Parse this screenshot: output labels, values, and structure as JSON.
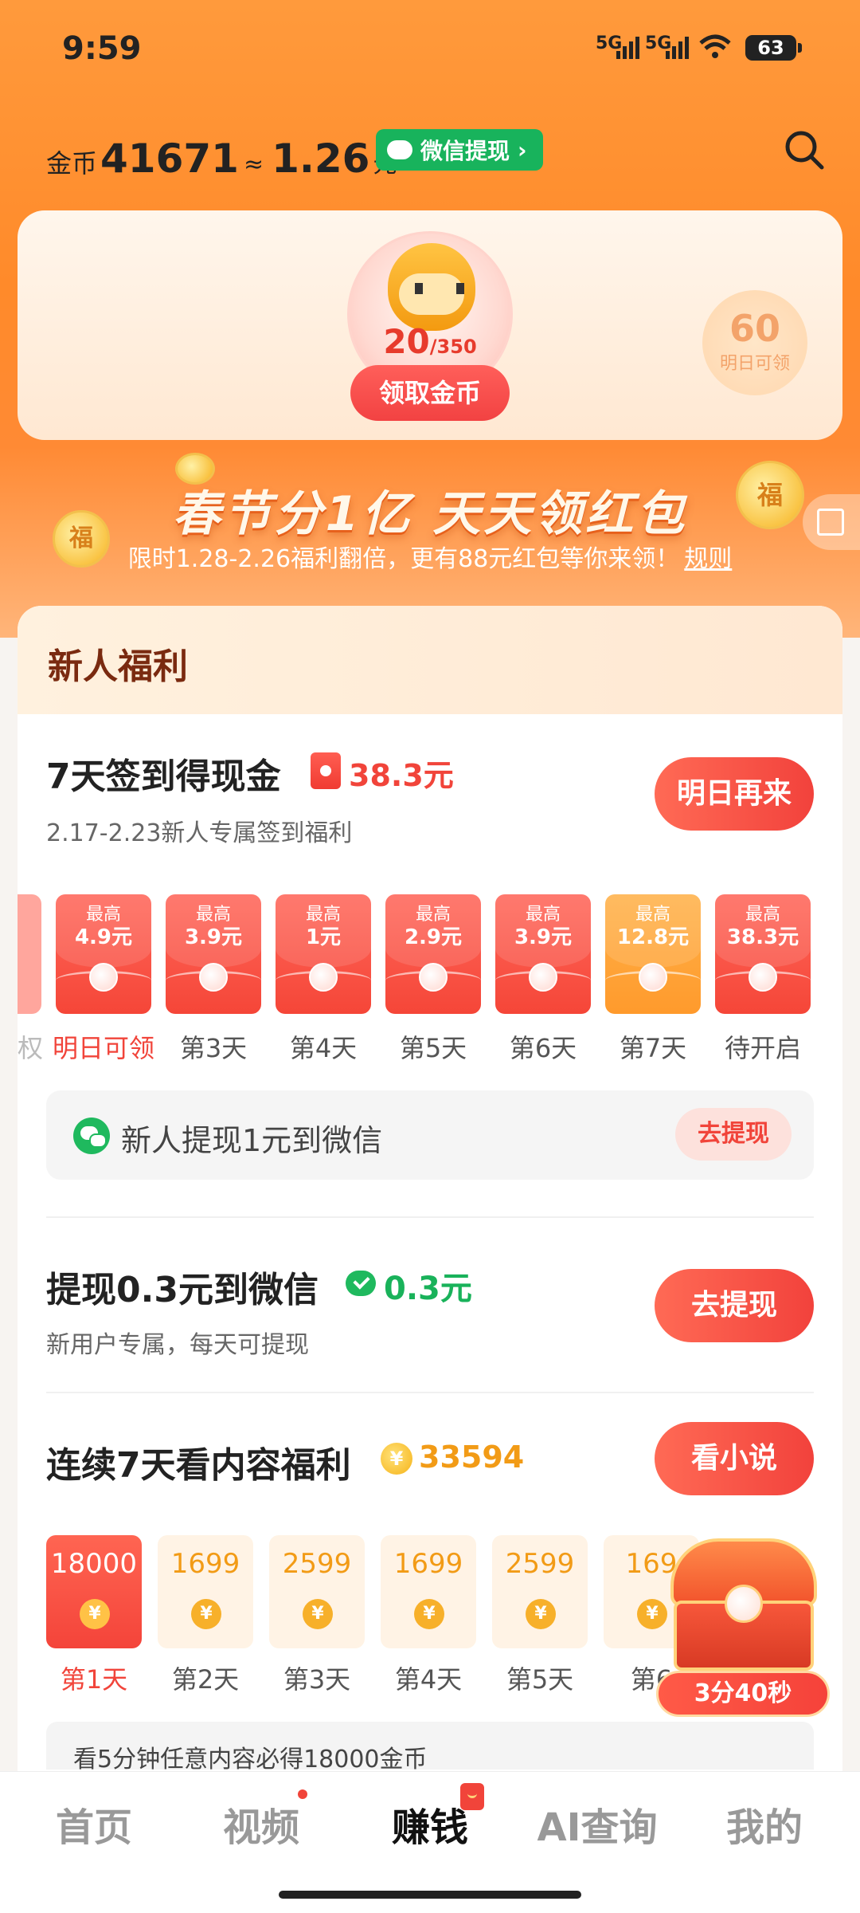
{
  "status_bar": {
    "time": "9:59",
    "sig1": "5G",
    "sig2": "5G",
    "battery": "63"
  },
  "header": {
    "coin_label": "金币",
    "coin_value": "41671",
    "approx": "≈",
    "cash_value": "1.26",
    "cash_unit": "元",
    "wechat_withdraw": "微信提现",
    "wechat_chevron": "›"
  },
  "treasure": {
    "progress_current": "20",
    "progress_total": "/350",
    "claim_label": "领取金币",
    "tomorrow_value": "60",
    "tomorrow_label": "明日可领"
  },
  "festival": {
    "title": "春节分1亿 天天领红包",
    "subtitle": "限时1.28-2.26福利翻倍，更有88元红包等你来领！",
    "rule_link": "规则",
    "coin_char": "福"
  },
  "newbie": {
    "section_title": "新人福利",
    "checkin": {
      "title": "7天签到得现金",
      "amount": "38.3元",
      "subtitle": "2.17-2.23新人专属签到福利",
      "button": "明日再来",
      "edge_label": "权",
      "packets": [
        {
          "top": "最高",
          "value": "4.9元",
          "label": "明日可领",
          "style": "red"
        },
        {
          "top": "最高",
          "value": "3.9元",
          "label": "第3天",
          "style": "red"
        },
        {
          "top": "最高",
          "value": "1元",
          "label": "第4天",
          "style": "red"
        },
        {
          "top": "最高",
          "value": "2.9元",
          "label": "第5天",
          "style": "red"
        },
        {
          "top": "最高",
          "value": "3.9元",
          "label": "第6天",
          "style": "red"
        },
        {
          "top": "最高",
          "value": "12.8元",
          "label": "第7天",
          "style": "gold"
        },
        {
          "top": "最高",
          "value": "38.3元",
          "label": "待开启",
          "style": "red"
        }
      ]
    },
    "withdraw_bar": {
      "text": "新人提现1元到微信",
      "button": "去提现"
    }
  },
  "withdraw_task": {
    "title": "提现0.3元到微信",
    "amount": "0.3元",
    "subtitle": "新用户专属，每天可提现",
    "button": "去提现"
  },
  "content_task": {
    "title": "连续7天看内容福利",
    "amount": "33594",
    "button": "看小说",
    "coin_symbol": "¥",
    "days": [
      {
        "value": "18000",
        "label": "第1天",
        "active": true
      },
      {
        "value": "1699",
        "label": "第2天",
        "active": false
      },
      {
        "value": "2599",
        "label": "第3天",
        "active": false
      },
      {
        "value": "1699",
        "label": "第4天",
        "active": false
      },
      {
        "value": "2599",
        "label": "第5天",
        "active": false
      },
      {
        "value": "169",
        "label": "第6",
        "active": false
      }
    ],
    "tip": "看5分钟任意内容必得18000金币"
  },
  "chest": {
    "timer": "3分40秒"
  },
  "bottom_nav": {
    "items": [
      "首页",
      "视频",
      "赚钱",
      "AI查询",
      "我的"
    ],
    "active_index": 2
  },
  "colors": {
    "accent_orange": "#ff8a2a",
    "red": "#f1443a",
    "wechat_green": "#18b35c",
    "gold": "#f29b16"
  }
}
